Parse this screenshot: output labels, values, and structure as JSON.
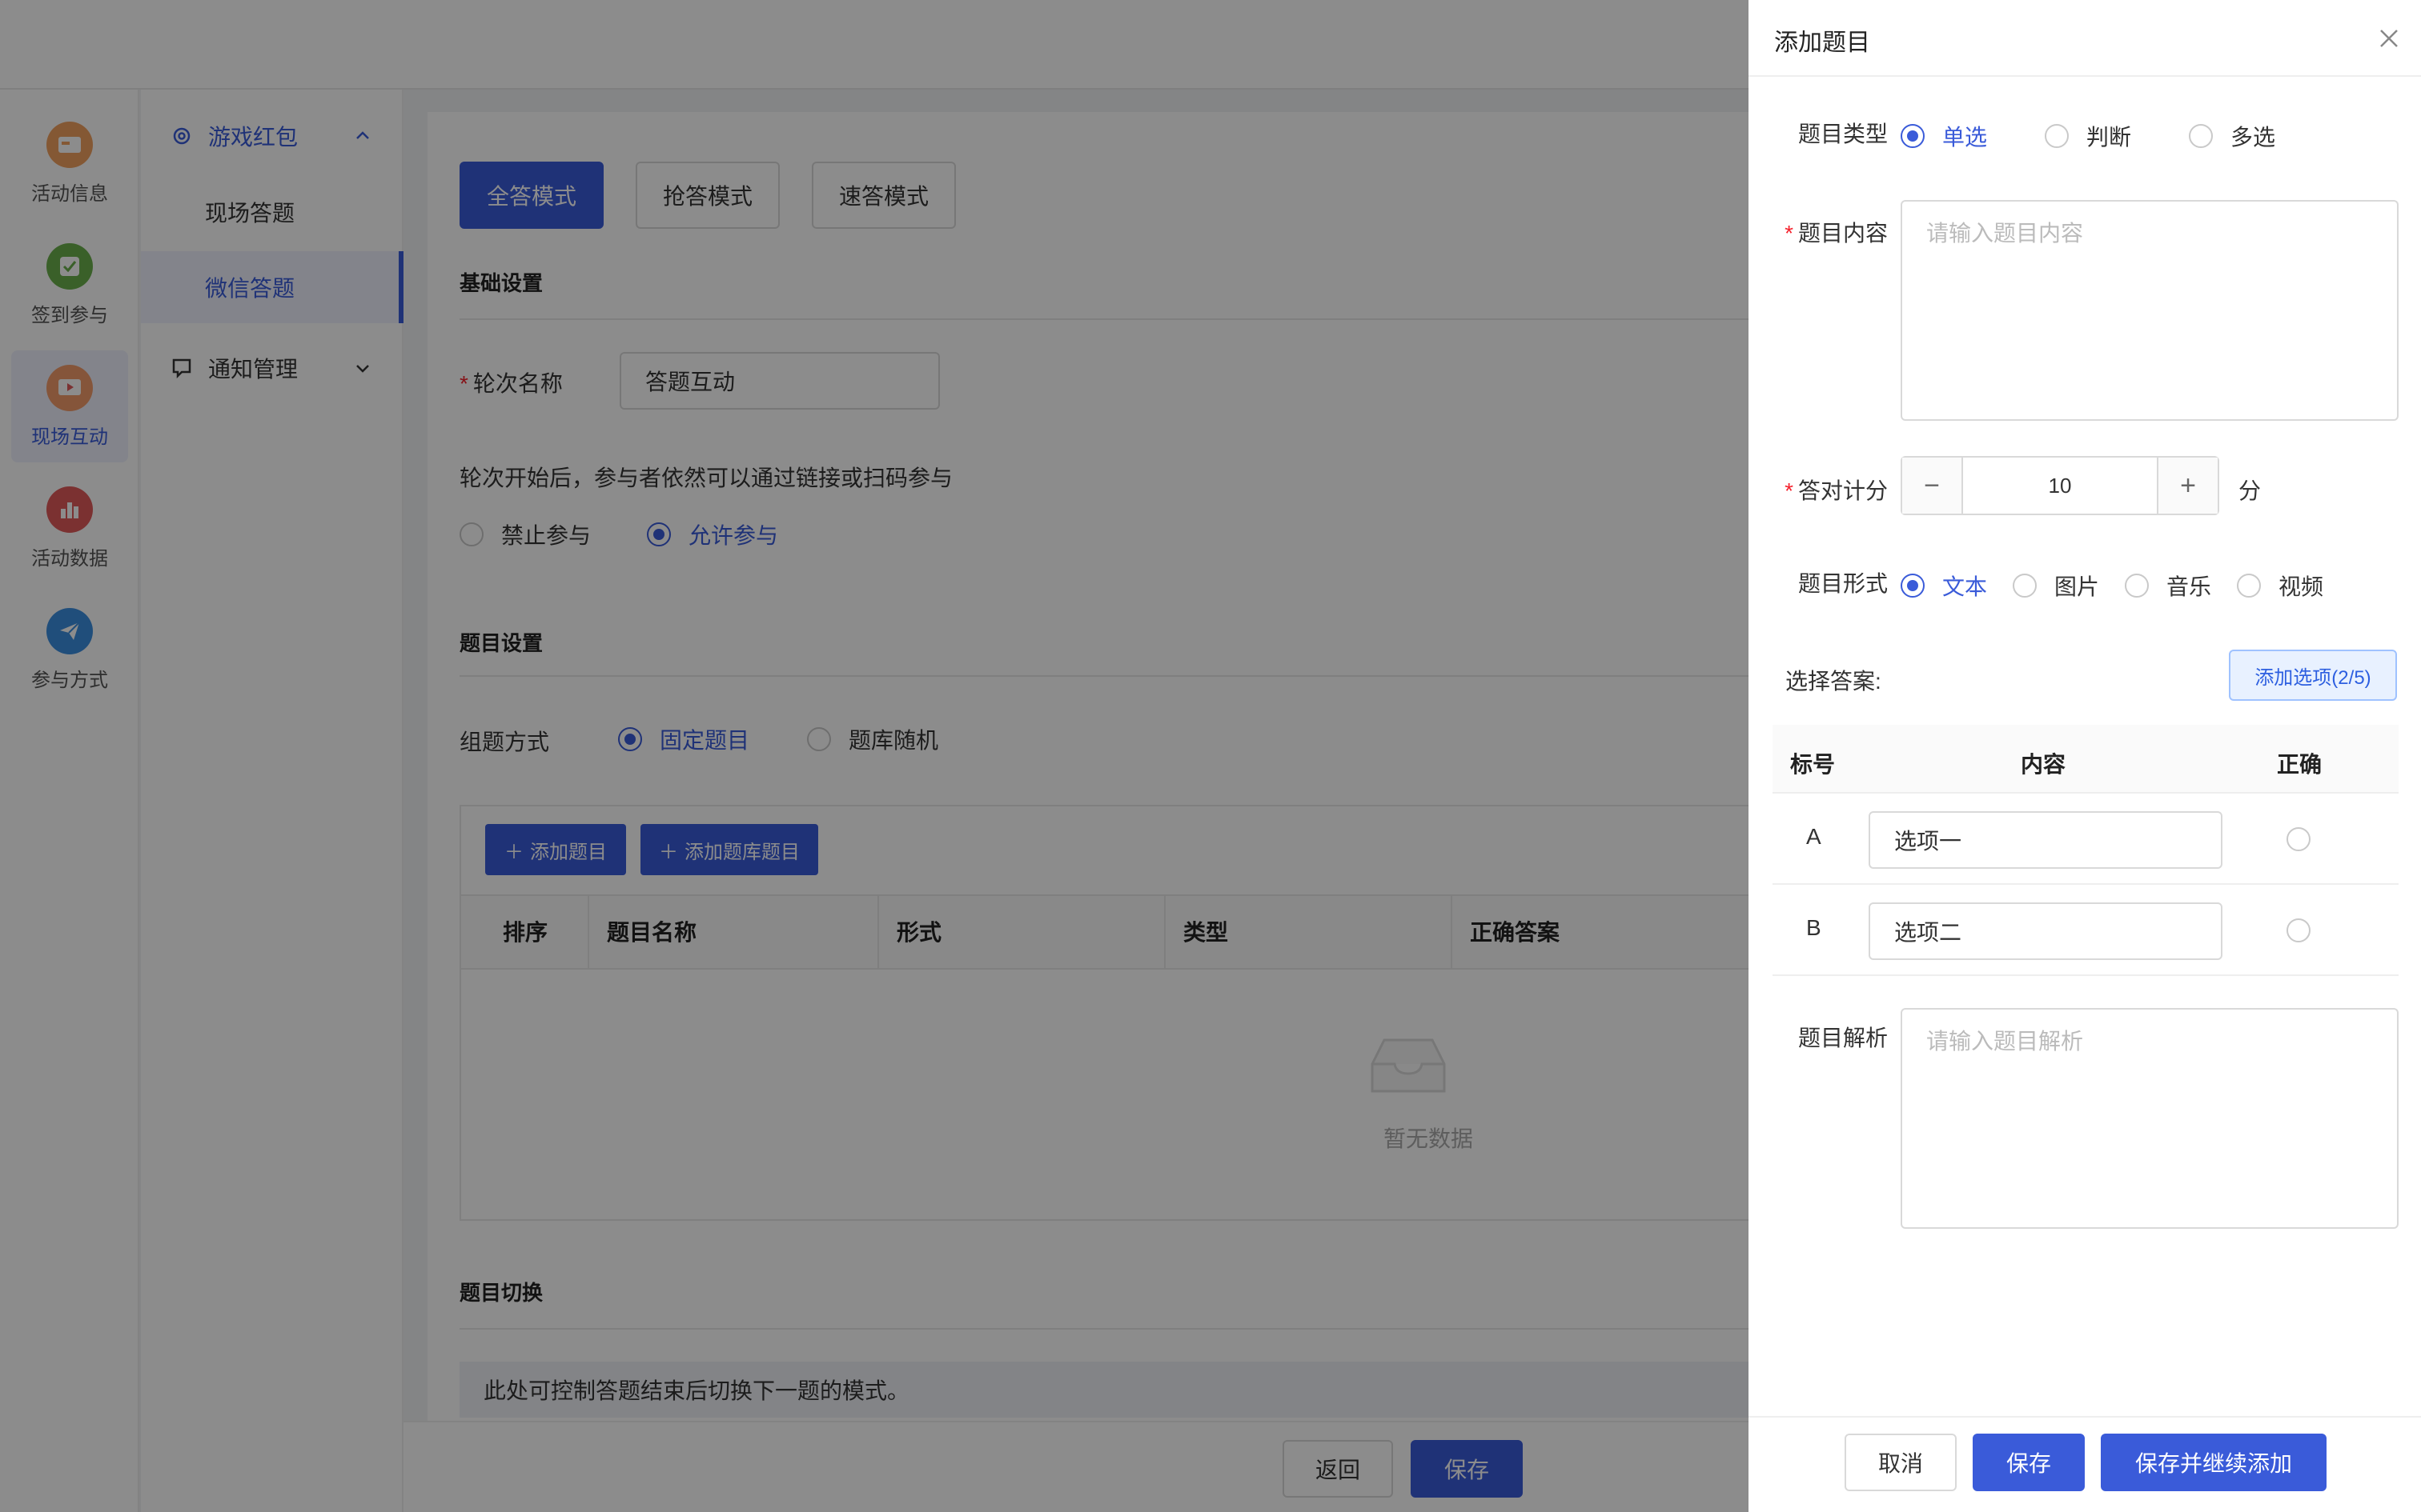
{
  "rail": {
    "items": [
      {
        "label": "活动信息",
        "icon": "ticket-icon",
        "color": "#f0a060",
        "active": false
      },
      {
        "label": "签到参与",
        "icon": "checkin-icon",
        "color": "#6ab04c",
        "active": false
      },
      {
        "label": "现场互动",
        "icon": "play-icon",
        "color": "#f39c6b",
        "active": true
      },
      {
        "label": "活动数据",
        "icon": "bar-chart-icon",
        "color": "#e05a5a",
        "active": false
      },
      {
        "label": "参与方式",
        "icon": "paper-plane-icon",
        "color": "#3b8ee0",
        "active": false
      }
    ]
  },
  "subnav": {
    "group1": "游戏红包",
    "item1": "现场答题",
    "item2": "微信答题",
    "group2": "通知管理"
  },
  "main": {
    "modes": [
      "全答模式",
      "抢答模式",
      "速答模式"
    ],
    "basic_title": "基础设置",
    "round_label": "轮次名称",
    "round_value": "答题互动",
    "rule_text": "轮次开始后，参与者依然可以通过链接或扫码参与",
    "radio_forbid": "禁止参与",
    "radio_allow": "允许参与",
    "question_title": "题目设置",
    "compose_label": "组题方式",
    "radio_fixed": "固定题目",
    "radio_random": "题库随机",
    "add_question_btn": "添加题目",
    "add_bank_btn": "添加题库题目",
    "columns": [
      "排序",
      "题目名称",
      "形式",
      "类型",
      "正确答案"
    ],
    "empty_text": "暂无数据",
    "switch_title": "题目切换",
    "switch_notice": "此处可控制答题结束后切换下一题的模式。",
    "back_btn": "返回",
    "save_btn": "保存"
  },
  "drawer": {
    "title": "添加题目",
    "type_label": "题目类型",
    "type_options": [
      "单选",
      "判断",
      "多选"
    ],
    "content_label": "题目内容",
    "content_placeholder": "请输入题目内容",
    "score_label": "答对计分",
    "score_value": "10",
    "score_unit": "分",
    "form_label": "题目形式",
    "form_options": [
      "文本",
      "图片",
      "音乐",
      "视频"
    ],
    "answer_label": "选择答案:",
    "add_option_btn": "添加选项(2/5)",
    "answer_columns": [
      "标号",
      "内容",
      "正确"
    ],
    "options": [
      {
        "key": "A",
        "value": "选项一"
      },
      {
        "key": "B",
        "value": "选项二"
      }
    ],
    "analysis_label": "题目解析",
    "analysis_placeholder": "请输入题目解析",
    "cancel_btn": "取消",
    "save_btn": "保存",
    "save_continue_btn": "保存并继续添加"
  },
  "colors": {
    "primary": "#3a5bd9",
    "required": "#f5222d"
  }
}
